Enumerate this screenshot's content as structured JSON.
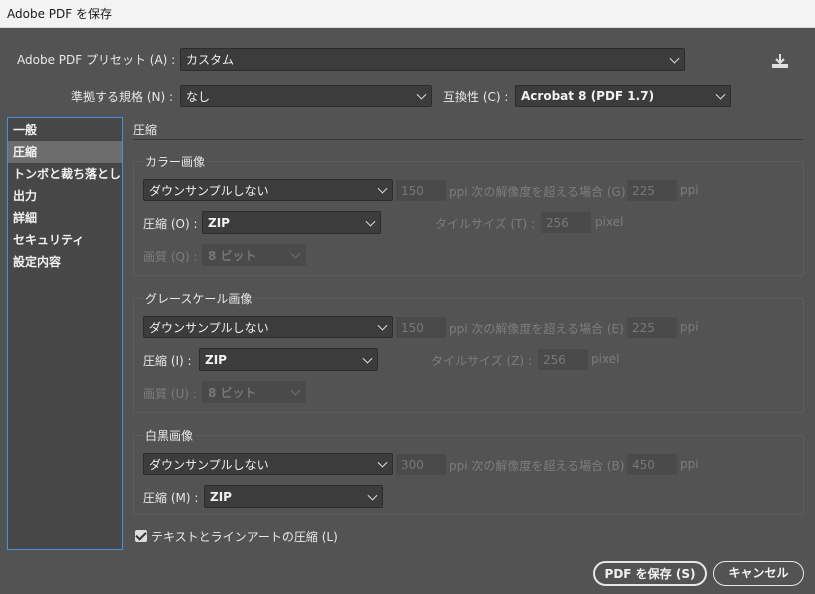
{
  "window": {
    "title": "Adobe PDF を保存"
  },
  "header": {
    "preset_label": "Adobe PDF プリセット (A) :",
    "preset_value": "カスタム",
    "standard_label": "準拠する規格 (N) :",
    "standard_value": "なし",
    "compat_label": "互換性 (C) :",
    "compat_value": "Acrobat 8 (PDF 1.7)"
  },
  "sidebar": {
    "items": [
      {
        "label": "一般"
      },
      {
        "label": "圧縮"
      },
      {
        "label": "トンボと裁ち落とし"
      },
      {
        "label": "出力"
      },
      {
        "label": "詳細"
      },
      {
        "label": "セキュリティ"
      },
      {
        "label": "設定内容"
      }
    ],
    "selected": "圧縮"
  },
  "section": {
    "title": "圧縮"
  },
  "color_images": {
    "title": "カラー画像",
    "sampling": "ダウンサンプルしない",
    "ppi_value": "150",
    "ppi_text": "ppi 次の解像度を超える場合 (G)",
    "above_value": "225",
    "above_unit": "ppi",
    "compression_label": "圧縮 (O) :",
    "compression_value": "ZIP",
    "tile_label": "タイルサイズ (T) :",
    "tile_value": "256",
    "tile_unit": "pixel",
    "quality_label": "画質 (Q) :",
    "quality_value": "8 ビット"
  },
  "gray_images": {
    "title": "グレースケール画像",
    "sampling": "ダウンサンプルしない",
    "ppi_value": "150",
    "ppi_text": "ppi 次の解像度を超える場合 (E)",
    "above_value": "225",
    "above_unit": "ppi",
    "compression_label": "圧縮 (I) :",
    "compression_value": "ZIP",
    "tile_label": "タイルサイズ (Z) :",
    "tile_value": "256",
    "tile_unit": "pixel",
    "quality_label": "画質 (U) :",
    "quality_value": "8 ビット"
  },
  "mono_images": {
    "title": "白黒画像",
    "sampling": "ダウンサンプルしない",
    "ppi_value": "300",
    "ppi_text": "ppi 次の解像度を超える場合 (B)",
    "above_value": "450",
    "above_unit": "ppi",
    "compression_label": "圧縮 (M) :",
    "compression_value": "ZIP"
  },
  "options": {
    "compress_text_label": "テキストとラインアートの圧縮 (L)",
    "compress_text_checked": true
  },
  "buttons": {
    "save": "PDF を保存 (S)",
    "cancel": "キャンセル"
  },
  "icons": {
    "save_preset": "download-icon"
  }
}
